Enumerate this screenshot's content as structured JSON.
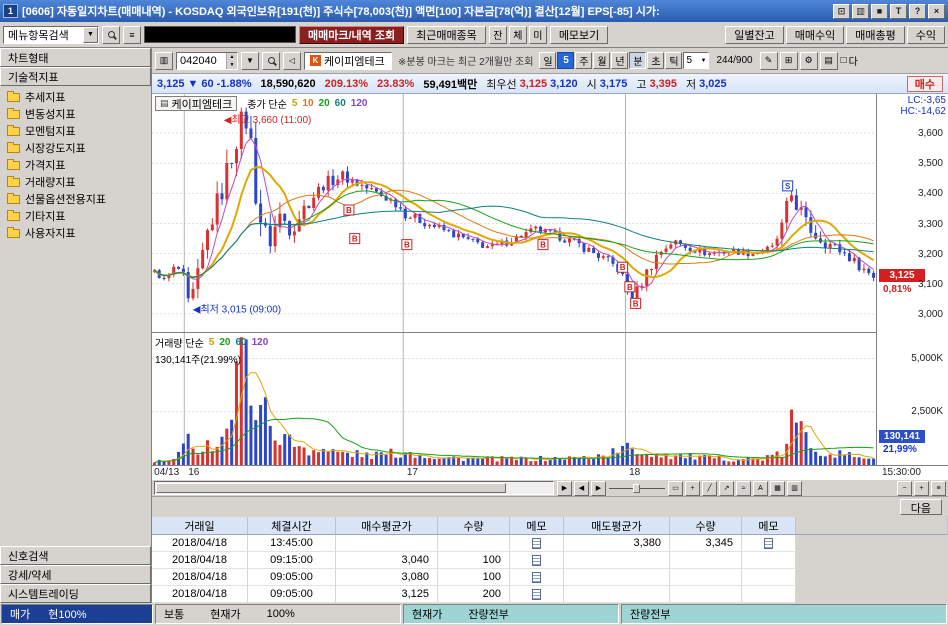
{
  "glyphs": {
    "down": "▼",
    "up": "▲",
    "left": "◀",
    "right": "▶",
    "chart": "▥",
    "tag": "▤",
    "menu": "≡",
    "speaker": "◁",
    "checkbox": "□"
  },
  "window": {
    "icon_label": "1",
    "title": "[0606] 자동일지차트(매매내역) - KOSDAQ 외국인보유[191(천)] 주식수[78,003(천)] 액면[100] 자본금[78(억)] 결산[12월] EPS[-85] 시가:",
    "controls": [
      {
        "name": "layout-icon",
        "glyph": "⊡"
      },
      {
        "name": "panel-icon",
        "glyph": "▥"
      },
      {
        "name": "capture-icon",
        "glyph": "■"
      },
      {
        "name": "tool-icon",
        "glyph": "T"
      },
      {
        "name": "help-icon",
        "glyph": "?"
      },
      {
        "name": "close-icon",
        "glyph": "×"
      }
    ]
  },
  "toolbar": {
    "menu_search_label": "메뉴항목검색",
    "trade_mark_button": "매매마크/내역 조회",
    "recent_stocks_button": "최근매매종목",
    "mini_buttons": [
      "잔",
      "체",
      "미"
    ],
    "memo_button": "메모보기",
    "right_buttons": [
      "일별잔고",
      "매매수익",
      "매매총평",
      "수익"
    ]
  },
  "sidebar": {
    "chart_type_header": "차트형태",
    "technical_header": "기술적지표",
    "items": [
      "추세지표",
      "변동성지표",
      "모멘텀지표",
      "시장강도지표",
      "가격지표",
      "거래량지표",
      "선물옵션전용지표",
      "기타지표",
      "사용자지표"
    ],
    "bottom_items": [
      "신호검색",
      "강세/약세",
      "시스템트레이딩"
    ]
  },
  "chart_toolbar": {
    "stock_code": "042040",
    "stock_name": "케이피엠테크",
    "stock_flag": "K",
    "note": "※분봉 마크는 최근 2개월만 조회",
    "periods": [
      {
        "label": "일",
        "kind": "btn",
        "sel": false
      },
      {
        "label": "5",
        "kind": "value",
        "sel": false
      },
      {
        "label": "주",
        "kind": "btn",
        "sel": false
      },
      {
        "label": "월",
        "kind": "btn",
        "sel": false
      },
      {
        "label": "년",
        "kind": "btn",
        "sel": false
      },
      {
        "label": "분",
        "kind": "btn",
        "sel": true
      },
      {
        "label": "초",
        "kind": "btn",
        "sel": false
      },
      {
        "label": "틱",
        "kind": "btn",
        "sel": false
      },
      {
        "label": "5",
        "kind": "spin",
        "sel": false
      }
    ],
    "count": "244/900",
    "right_icons": [
      {
        "name": "pen-icon",
        "glyph": "✎"
      },
      {
        "name": "compare-icon",
        "glyph": "⊞"
      },
      {
        "name": "settings-icon",
        "glyph": "⚙"
      },
      {
        "name": "list-icon",
        "glyph": "▤"
      }
    ],
    "checkbox_label": "다"
  },
  "price_bar": {
    "price": "3,125",
    "direction": "▼",
    "change": "60",
    "change_pct": "-1.88%",
    "volume": "18,590,620",
    "volume_ratio": "209.13%",
    "turnover": "23.83%",
    "amount": "59,491백만",
    "best_label": "최우선",
    "best_bid": "3,125",
    "best_ask": "3,120",
    "open_label": "시",
    "open": "3,175",
    "high_label": "고",
    "high": "3,395",
    "low_label": "저",
    "low": "3,025",
    "buy_button": "매수"
  },
  "chart": {
    "stock_label": "케이피엠테크",
    "price_legend_label": "종가 단순",
    "price_legend": [
      {
        "n": "5",
        "color": "#c8a000"
      },
      {
        "n": "10",
        "color": "#e07818"
      },
      {
        "n": "20",
        "color": "#18a018"
      },
      {
        "n": "60",
        "color": "#108080"
      },
      {
        "n": "120",
        "color": "#8a46c0"
      }
    ],
    "volume_legend_label": "거래량 단순",
    "volume_legend": [
      {
        "n": "5",
        "color": "#c8a000"
      },
      {
        "n": "20",
        "color": "#18a018"
      },
      {
        "n": "60",
        "color": "#108080"
      },
      {
        "n": "120",
        "color": "#8a46c0"
      }
    ],
    "volume_value_text": "130,141주(21.99%)",
    "high_annotation": {
      "text": "최고 3,660 (11:00)",
      "t": 0.135,
      "price": 3660
    },
    "low_annotation": {
      "text": "최저 3,015 (09:00)",
      "t": 0.048,
      "price": 3015
    },
    "high_color": "#d42020",
    "low_color": "#1430c8",
    "lc_text": "LC:-3,65",
    "hc_text": "HC:-14,62",
    "price_badge": {
      "label": "3,125",
      "pct": "0,81%",
      "value": 3125
    },
    "volume_badge": {
      "label": "130,141",
      "pct": "21,99%"
    },
    "y_ticks": [
      3600,
      3500,
      3400,
      3300,
      3200,
      3100,
      3000
    ],
    "volume_ticks": [
      {
        "v": 5000,
        "label": "5,000K"
      },
      {
        "v": 2500,
        "label": "2,500K"
      }
    ],
    "x_ticks": [
      {
        "label": "04/13",
        "t": 0.003
      },
      {
        "label": "16",
        "t": 0.05
      },
      {
        "label": "17",
        "t": 0.352
      },
      {
        "label": "18",
        "t": 0.659
      }
    ],
    "time_label": "15:30:00",
    "b_marks": [
      [
        0.272,
        3345
      ],
      [
        0.28,
        3250
      ],
      [
        0.352,
        3230
      ],
      [
        0.54,
        3230
      ],
      [
        0.65,
        3155
      ],
      [
        0.66,
        3090
      ],
      [
        0.668,
        3035
      ]
    ],
    "s_marks": [
      [
        0.878,
        3425
      ]
    ],
    "b_color": "#cc2222",
    "s_color": "#2244cc"
  },
  "chart_render": {
    "n_candles": 150,
    "price_min": 2940,
    "price_max": 3730,
    "volume_max": 6200,
    "up_color": "#d93030",
    "down_color": "#2d46c8",
    "price_gridlines": [
      3000,
      3100,
      3200,
      3300,
      3400,
      3500,
      3600
    ],
    "volume_gridlines": [
      2500,
      5000
    ],
    "day_boundaries": [
      0.0446,
      0.347,
      0.654
    ],
    "close_keypoints": [
      [
        0,
        3140
      ],
      [
        0.015,
        3110
      ],
      [
        0.03,
        3160
      ],
      [
        0.042,
        3120
      ],
      [
        0.048,
        3015
      ],
      [
        0.06,
        3120
      ],
      [
        0.075,
        3280
      ],
      [
        0.095,
        3420
      ],
      [
        0.115,
        3600
      ],
      [
        0.13,
        3660
      ],
      [
        0.14,
        3420
      ],
      [
        0.15,
        3280
      ],
      [
        0.16,
        3240
      ],
      [
        0.175,
        3330
      ],
      [
        0.19,
        3280
      ],
      [
        0.21,
        3360
      ],
      [
        0.235,
        3430
      ],
      [
        0.26,
        3460
      ],
      [
        0.285,
        3430
      ],
      [
        0.31,
        3400
      ],
      [
        0.335,
        3370
      ],
      [
        0.35,
        3330
      ],
      [
        0.38,
        3300
      ],
      [
        0.41,
        3270
      ],
      [
        0.44,
        3240
      ],
      [
        0.47,
        3220
      ],
      [
        0.5,
        3250
      ],
      [
        0.53,
        3280
      ],
      [
        0.56,
        3260
      ],
      [
        0.59,
        3230
      ],
      [
        0.62,
        3190
      ],
      [
        0.645,
        3150
      ],
      [
        0.655,
        3100
      ],
      [
        0.665,
        3040
      ],
      [
        0.68,
        3120
      ],
      [
        0.7,
        3200
      ],
      [
        0.72,
        3240
      ],
      [
        0.745,
        3220
      ],
      [
        0.77,
        3200
      ],
      [
        0.8,
        3210
      ],
      [
        0.83,
        3200
      ],
      [
        0.86,
        3220
      ],
      [
        0.875,
        3300
      ],
      [
        0.885,
        3400
      ],
      [
        0.895,
        3360
      ],
      [
        0.905,
        3300
      ],
      [
        0.92,
        3260
      ],
      [
        0.94,
        3230
      ],
      [
        0.96,
        3200
      ],
      [
        0.98,
        3160
      ],
      [
        1,
        3125
      ]
    ],
    "volatility_keypoints": [
      [
        0,
        18
      ],
      [
        0.04,
        30
      ],
      [
        0.05,
        60
      ],
      [
        0.09,
        90
      ],
      [
        0.13,
        130
      ],
      [
        0.15,
        100
      ],
      [
        0.18,
        70
      ],
      [
        0.22,
        50
      ],
      [
        0.28,
        40
      ],
      [
        0.35,
        35
      ],
      [
        0.45,
        30
      ],
      [
        0.55,
        28
      ],
      [
        0.62,
        35
      ],
      [
        0.655,
        45
      ],
      [
        0.67,
        50
      ],
      [
        0.72,
        35
      ],
      [
        0.8,
        22
      ],
      [
        0.86,
        25
      ],
      [
        0.885,
        90
      ],
      [
        0.91,
        60
      ],
      [
        0.95,
        40
      ],
      [
        1,
        30
      ]
    ],
    "volume_keypoints": [
      [
        0,
        150
      ],
      [
        0.03,
        250
      ],
      [
        0.048,
        1200
      ],
      [
        0.06,
        800
      ],
      [
        0.08,
        1000
      ],
      [
        0.1,
        1500
      ],
      [
        0.125,
        5600
      ],
      [
        0.135,
        4200
      ],
      [
        0.145,
        3000
      ],
      [
        0.16,
        2000
      ],
      [
        0.18,
        1200
      ],
      [
        0.21,
        800
      ],
      [
        0.25,
        600
      ],
      [
        0.3,
        450
      ],
      [
        0.35,
        600
      ],
      [
        0.4,
        350
      ],
      [
        0.45,
        300
      ],
      [
        0.5,
        280
      ],
      [
        0.55,
        300
      ],
      [
        0.6,
        350
      ],
      [
        0.63,
        500
      ],
      [
        0.655,
        800
      ],
      [
        0.68,
        600
      ],
      [
        0.72,
        450
      ],
      [
        0.78,
        300
      ],
      [
        0.84,
        280
      ],
      [
        0.875,
        500
      ],
      [
        0.885,
        2100
      ],
      [
        0.895,
        1700
      ],
      [
        0.92,
        800
      ],
      [
        0.95,
        500
      ],
      [
        1,
        350
      ]
    ],
    "ma_lines": [
      {
        "window": 5,
        "color": "#c048c0",
        "width": 1
      },
      {
        "window": 10,
        "color": "#e0a800",
        "width": 2
      },
      {
        "window": 20,
        "color": "#e07818",
        "width": 1
      },
      {
        "window": 30,
        "color": "#18a018",
        "width": 1
      },
      {
        "window": 60,
        "color": "#108080",
        "width": 1
      }
    ],
    "volume_ma_lines": [
      {
        "window": 5,
        "color": "#e0a800"
      },
      {
        "window": 20,
        "color": "#18a018"
      }
    ]
  },
  "scroll_row": {
    "nav_icons": [
      {
        "name": "scroll-step-right-icon",
        "glyph": "▶"
      },
      {
        "name": "page-left-icon",
        "glyph": "◀"
      },
      {
        "name": "page-right-icon",
        "glyph": "▶"
      }
    ],
    "tool_icons": [
      {
        "name": "select-tool-icon",
        "glyph": "▭"
      },
      {
        "name": "crosshair-tool-icon",
        "glyph": "+"
      },
      {
        "name": "trendline-tool-icon",
        "glyph": "╱"
      },
      {
        "name": "arrow-tool-icon",
        "glyph": "↗"
      },
      {
        "name": "wave-tool-icon",
        "glyph": "≈"
      },
      {
        "name": "text-tool-icon",
        "glyph": "A"
      },
      {
        "name": "grid-tool-icon",
        "glyph": "▦"
      },
      {
        "name": "chart-style-tool-icon",
        "glyph": "▥"
      }
    ],
    "zoom_icons": [
      {
        "name": "zoom-out-icon",
        "glyph": "−"
      },
      {
        "name": "zoom-in-icon",
        "glyph": "+"
      },
      {
        "name": "tools-menu-icon",
        "glyph": "≡"
      }
    ]
  },
  "next_button": "다음",
  "table": {
    "headers": [
      "거래일",
      "체결시간",
      "매수평균가",
      "수량",
      "메모",
      "매도평균가",
      "수량",
      "메모"
    ],
    "rows": [
      {
        "date": "2018/04/18",
        "time": "13:45:00",
        "buy_price": "",
        "buy_qty": "",
        "buy_memo": true,
        "sell_price": "3,380",
        "sell_qty": "3,345",
        "sell_memo": true
      },
      {
        "date": "2018/04/18",
        "time": "09:15:00",
        "buy_price": "3,040",
        "buy_qty": "100",
        "buy_memo": true,
        "sell_price": "",
        "sell_qty": "",
        "sell_memo": false
      },
      {
        "date": "2018/04/18",
        "time": "09:05:00",
        "buy_price": "3,080",
        "buy_qty": "100",
        "buy_memo": true,
        "sell_price": "",
        "sell_qty": "",
        "sell_memo": false
      },
      {
        "date": "2018/04/18",
        "time": "09:05:00",
        "buy_price": "3,125",
        "buy_qty": "200",
        "buy_memo": true,
        "sell_price": "",
        "sell_qty": "",
        "sell_memo": false
      }
    ]
  },
  "status_bar": {
    "seg1": [
      "매가",
      "현100%"
    ],
    "seg2": [
      "보통",
      "현재가",
      "100%"
    ],
    "seg3": [
      "현재가",
      "잔량전부"
    ],
    "seg4": [
      "잔량전부"
    ]
  }
}
